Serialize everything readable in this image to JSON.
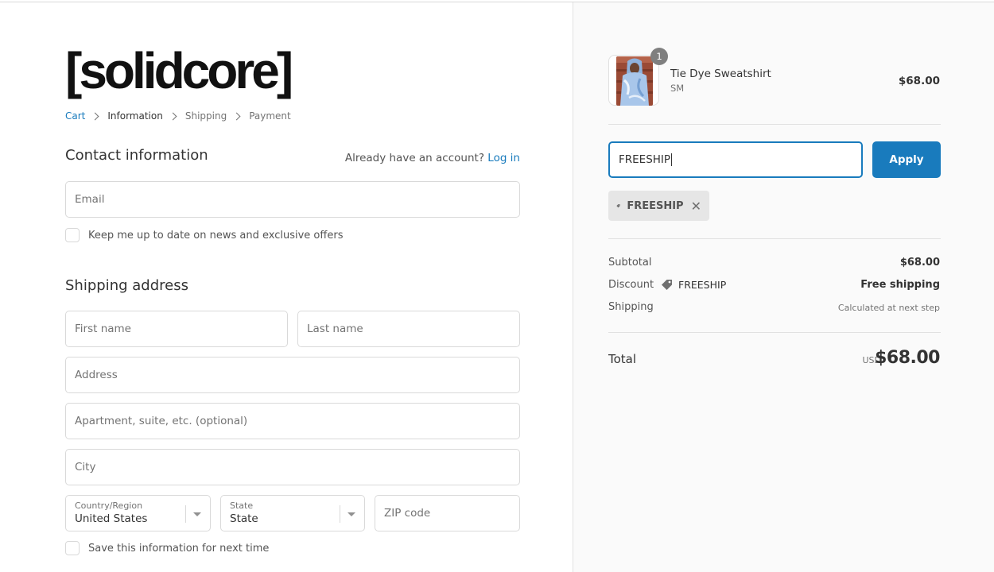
{
  "brand": {
    "logo_text": "[solidcore]"
  },
  "breadcrumb": [
    "Cart",
    "Information",
    "Shipping",
    "Payment"
  ],
  "contact": {
    "title": "Contact information",
    "account_prompt": "Already have an account?",
    "login_label": "Log in",
    "email_placeholder": "Email",
    "newsletter_label": "Keep me up to date on news and exclusive offers"
  },
  "shipping": {
    "title": "Shipping address",
    "first_name_placeholder": "First name",
    "last_name_placeholder": "Last name",
    "address_placeholder": "Address",
    "apartment_placeholder": "Apartment, suite, etc. (optional)",
    "city_placeholder": "City",
    "country_label": "Country/Region",
    "country_value": "United States",
    "state_label": "State",
    "state_value": "State",
    "zip_placeholder": "ZIP code",
    "save_label": "Save this information for next time"
  },
  "order": {
    "item": {
      "quantity": "1",
      "name": "Tie Dye Sweatshirt",
      "variant": "SM",
      "price": "$68.00",
      "thumbnail_icon": "product-photo"
    },
    "discount_input_value": "FREESHIP",
    "apply_label": "Apply",
    "applied_code": "FREESHIP",
    "subtotal_label": "Subtotal",
    "subtotal_value": "$68.00",
    "discount_label": "Discount",
    "discount_code": "FREESHIP",
    "discount_value": "Free shipping",
    "shipping_label": "Shipping",
    "shipping_value": "Calculated at next step",
    "total_label": "Total",
    "currency": "USD",
    "total_value": "$68.00"
  },
  "colors": {
    "accent": "#197bbd",
    "sidebar_bg": "#fafafa",
    "tag_bg": "#e6e6e6"
  }
}
